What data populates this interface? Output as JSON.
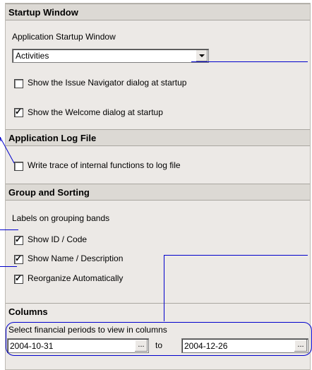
{
  "startup": {
    "header": "Startup Window",
    "label": "Application Startup Window",
    "selected": "Activities",
    "show_issue_navigator": "Show the Issue Navigator dialog at startup",
    "show_welcome": "Show the Welcome dialog at startup",
    "issue_navigator_checked": false,
    "welcome_checked": true
  },
  "log": {
    "header": "Application Log File",
    "write_trace": "Write trace of internal functions to log file",
    "write_trace_checked": false
  },
  "grouping": {
    "header": "Group and Sorting",
    "label": "Labels on grouping bands",
    "show_id": "Show ID / Code",
    "show_name": "Show Name / Description",
    "reorganize": "Reorganize Automatically",
    "show_id_checked": true,
    "show_name_checked": true,
    "reorganize_checked": true
  },
  "columns": {
    "header": "Columns",
    "label": "Select financial periods to view in columns",
    "from": "2004-10-31",
    "to_label": "to",
    "to": "2004-12-26",
    "browse": "..."
  },
  "colors": {
    "callout": "#0000cc",
    "panel": "#ece9e6",
    "header": "#dcd9d4"
  }
}
